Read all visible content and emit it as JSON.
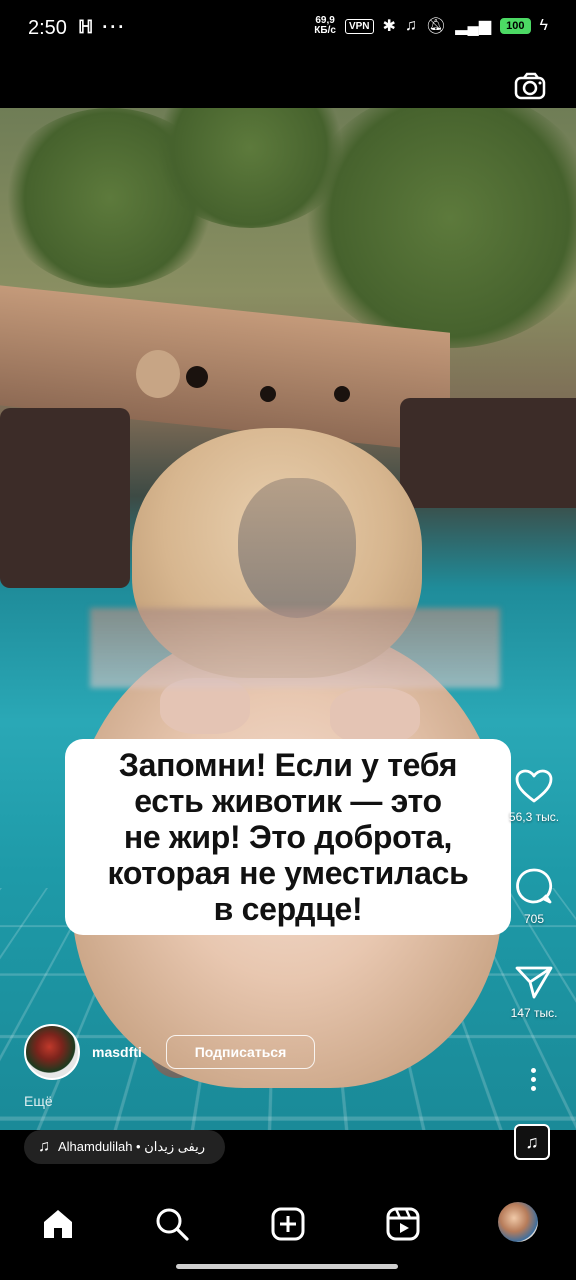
{
  "status_bar": {
    "time": "2:50",
    "left_icons": "ℍ ···",
    "net_speed": "69,9\nКБ/с",
    "vpn": "VPN",
    "battery": "100",
    "icons": [
      "bluetooth-icon",
      "headset-icon",
      "bell-off-icon",
      "signal-4g-icon",
      "charging-icon"
    ]
  },
  "header": {
    "camera_icon": "camera-icon"
  },
  "caption": {
    "text": "Запомни! Если у тебя\nесть животик — это\nне жир! Это доброта,\nкоторая не уместилась\nв сердце!"
  },
  "actions": {
    "like_count": "56,3 тыс.",
    "comment_count": "705",
    "share_count": "147 тыс."
  },
  "author": {
    "username": "masdfti",
    "follow_label": "Подписаться",
    "more_label": "Ещё"
  },
  "music": {
    "track": "Alhamdulilah • ريفى زيدان"
  },
  "nav": {
    "items": [
      "home-icon",
      "search-icon",
      "create-icon",
      "reels-icon",
      "profile-avatar"
    ]
  },
  "colors": {
    "battery": "#4cd964",
    "background": "#000000"
  }
}
